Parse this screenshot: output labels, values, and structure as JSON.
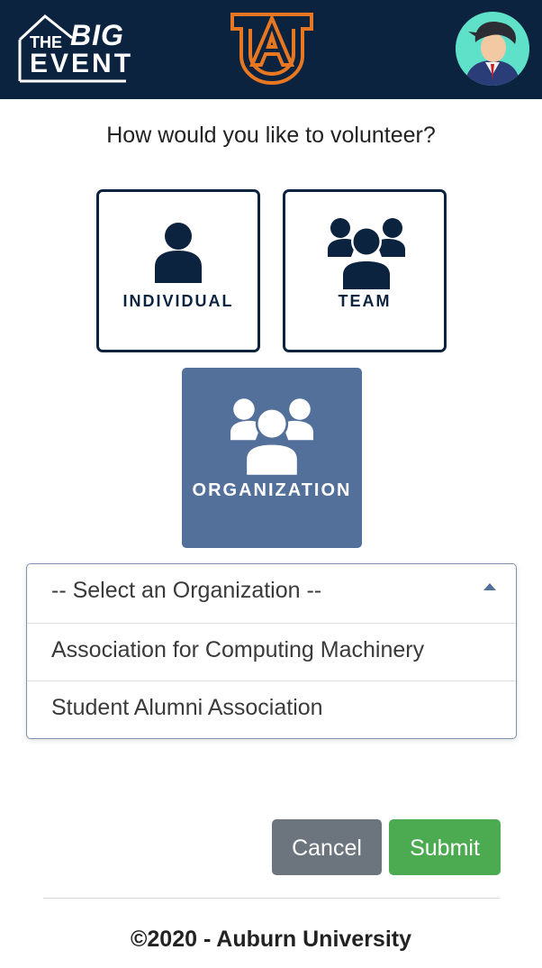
{
  "navbar": {
    "logo_left_text": {
      "line1": "THE",
      "line2": "BIG",
      "line3": "EVENT"
    },
    "logo_center": "AU",
    "avatar_icon": "user-avatar-icon"
  },
  "question": "How would you like to volunteer?",
  "options": [
    {
      "label": "INDIVIDUAL",
      "icon": "person-icon",
      "selected": false
    },
    {
      "label": "TEAM",
      "icon": "group-icon",
      "selected": false
    },
    {
      "label": "ORGANIZATION",
      "icon": "group-icon",
      "selected": true
    }
  ],
  "organization_select": {
    "placeholder": "-- Select an Organization --",
    "options": [
      "Association for Computing Machinery",
      "Student Alumni Association"
    ],
    "caret_icon": "caret-up-icon"
  },
  "buttons": {
    "cancel": "Cancel",
    "submit": "Submit"
  },
  "footer": "©2020 - Auburn University",
  "colors": {
    "navy": "#0c2340",
    "auburn_orange": "#e87722",
    "selected_card": "#52709a",
    "cancel": "#6c757d",
    "submit": "#4caa50"
  }
}
